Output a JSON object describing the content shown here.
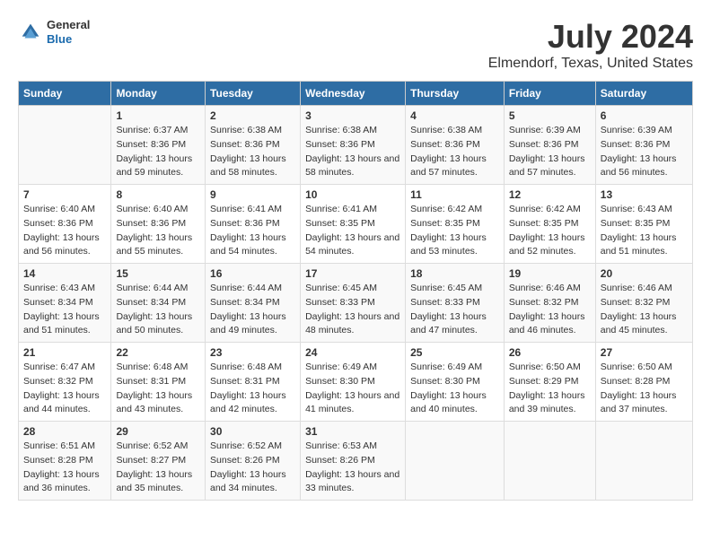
{
  "header": {
    "logo": {
      "general": "General",
      "blue": "Blue"
    },
    "title": "July 2024",
    "subtitle": "Elmendorf, Texas, United States"
  },
  "columns": [
    "Sunday",
    "Monday",
    "Tuesday",
    "Wednesday",
    "Thursday",
    "Friday",
    "Saturday"
  ],
  "weeks": [
    {
      "days": [
        {
          "num": "",
          "sunrise": "",
          "sunset": "",
          "daylight": ""
        },
        {
          "num": "1",
          "sunrise": "Sunrise: 6:37 AM",
          "sunset": "Sunset: 8:36 PM",
          "daylight": "Daylight: 13 hours and 59 minutes."
        },
        {
          "num": "2",
          "sunrise": "Sunrise: 6:38 AM",
          "sunset": "Sunset: 8:36 PM",
          "daylight": "Daylight: 13 hours and 58 minutes."
        },
        {
          "num": "3",
          "sunrise": "Sunrise: 6:38 AM",
          "sunset": "Sunset: 8:36 PM",
          "daylight": "Daylight: 13 hours and 58 minutes."
        },
        {
          "num": "4",
          "sunrise": "Sunrise: 6:38 AM",
          "sunset": "Sunset: 8:36 PM",
          "daylight": "Daylight: 13 hours and 57 minutes."
        },
        {
          "num": "5",
          "sunrise": "Sunrise: 6:39 AM",
          "sunset": "Sunset: 8:36 PM",
          "daylight": "Daylight: 13 hours and 57 minutes."
        },
        {
          "num": "6",
          "sunrise": "Sunrise: 6:39 AM",
          "sunset": "Sunset: 8:36 PM",
          "daylight": "Daylight: 13 hours and 56 minutes."
        }
      ]
    },
    {
      "days": [
        {
          "num": "7",
          "sunrise": "Sunrise: 6:40 AM",
          "sunset": "Sunset: 8:36 PM",
          "daylight": "Daylight: 13 hours and 56 minutes."
        },
        {
          "num": "8",
          "sunrise": "Sunrise: 6:40 AM",
          "sunset": "Sunset: 8:36 PM",
          "daylight": "Daylight: 13 hours and 55 minutes."
        },
        {
          "num": "9",
          "sunrise": "Sunrise: 6:41 AM",
          "sunset": "Sunset: 8:36 PM",
          "daylight": "Daylight: 13 hours and 54 minutes."
        },
        {
          "num": "10",
          "sunrise": "Sunrise: 6:41 AM",
          "sunset": "Sunset: 8:35 PM",
          "daylight": "Daylight: 13 hours and 54 minutes."
        },
        {
          "num": "11",
          "sunrise": "Sunrise: 6:42 AM",
          "sunset": "Sunset: 8:35 PM",
          "daylight": "Daylight: 13 hours and 53 minutes."
        },
        {
          "num": "12",
          "sunrise": "Sunrise: 6:42 AM",
          "sunset": "Sunset: 8:35 PM",
          "daylight": "Daylight: 13 hours and 52 minutes."
        },
        {
          "num": "13",
          "sunrise": "Sunrise: 6:43 AM",
          "sunset": "Sunset: 8:35 PM",
          "daylight": "Daylight: 13 hours and 51 minutes."
        }
      ]
    },
    {
      "days": [
        {
          "num": "14",
          "sunrise": "Sunrise: 6:43 AM",
          "sunset": "Sunset: 8:34 PM",
          "daylight": "Daylight: 13 hours and 51 minutes."
        },
        {
          "num": "15",
          "sunrise": "Sunrise: 6:44 AM",
          "sunset": "Sunset: 8:34 PM",
          "daylight": "Daylight: 13 hours and 50 minutes."
        },
        {
          "num": "16",
          "sunrise": "Sunrise: 6:44 AM",
          "sunset": "Sunset: 8:34 PM",
          "daylight": "Daylight: 13 hours and 49 minutes."
        },
        {
          "num": "17",
          "sunrise": "Sunrise: 6:45 AM",
          "sunset": "Sunset: 8:33 PM",
          "daylight": "Daylight: 13 hours and 48 minutes."
        },
        {
          "num": "18",
          "sunrise": "Sunrise: 6:45 AM",
          "sunset": "Sunset: 8:33 PM",
          "daylight": "Daylight: 13 hours and 47 minutes."
        },
        {
          "num": "19",
          "sunrise": "Sunrise: 6:46 AM",
          "sunset": "Sunset: 8:32 PM",
          "daylight": "Daylight: 13 hours and 46 minutes."
        },
        {
          "num": "20",
          "sunrise": "Sunrise: 6:46 AM",
          "sunset": "Sunset: 8:32 PM",
          "daylight": "Daylight: 13 hours and 45 minutes."
        }
      ]
    },
    {
      "days": [
        {
          "num": "21",
          "sunrise": "Sunrise: 6:47 AM",
          "sunset": "Sunset: 8:32 PM",
          "daylight": "Daylight: 13 hours and 44 minutes."
        },
        {
          "num": "22",
          "sunrise": "Sunrise: 6:48 AM",
          "sunset": "Sunset: 8:31 PM",
          "daylight": "Daylight: 13 hours and 43 minutes."
        },
        {
          "num": "23",
          "sunrise": "Sunrise: 6:48 AM",
          "sunset": "Sunset: 8:31 PM",
          "daylight": "Daylight: 13 hours and 42 minutes."
        },
        {
          "num": "24",
          "sunrise": "Sunrise: 6:49 AM",
          "sunset": "Sunset: 8:30 PM",
          "daylight": "Daylight: 13 hours and 41 minutes."
        },
        {
          "num": "25",
          "sunrise": "Sunrise: 6:49 AM",
          "sunset": "Sunset: 8:30 PM",
          "daylight": "Daylight: 13 hours and 40 minutes."
        },
        {
          "num": "26",
          "sunrise": "Sunrise: 6:50 AM",
          "sunset": "Sunset: 8:29 PM",
          "daylight": "Daylight: 13 hours and 39 minutes."
        },
        {
          "num": "27",
          "sunrise": "Sunrise: 6:50 AM",
          "sunset": "Sunset: 8:28 PM",
          "daylight": "Daylight: 13 hours and 37 minutes."
        }
      ]
    },
    {
      "days": [
        {
          "num": "28",
          "sunrise": "Sunrise: 6:51 AM",
          "sunset": "Sunset: 8:28 PM",
          "daylight": "Daylight: 13 hours and 36 minutes."
        },
        {
          "num": "29",
          "sunrise": "Sunrise: 6:52 AM",
          "sunset": "Sunset: 8:27 PM",
          "daylight": "Daylight: 13 hours and 35 minutes."
        },
        {
          "num": "30",
          "sunrise": "Sunrise: 6:52 AM",
          "sunset": "Sunset: 8:26 PM",
          "daylight": "Daylight: 13 hours and 34 minutes."
        },
        {
          "num": "31",
          "sunrise": "Sunrise: 6:53 AM",
          "sunset": "Sunset: 8:26 PM",
          "daylight": "Daylight: 13 hours and 33 minutes."
        },
        {
          "num": "",
          "sunrise": "",
          "sunset": "",
          "daylight": ""
        },
        {
          "num": "",
          "sunrise": "",
          "sunset": "",
          "daylight": ""
        },
        {
          "num": "",
          "sunrise": "",
          "sunset": "",
          "daylight": ""
        }
      ]
    }
  ]
}
